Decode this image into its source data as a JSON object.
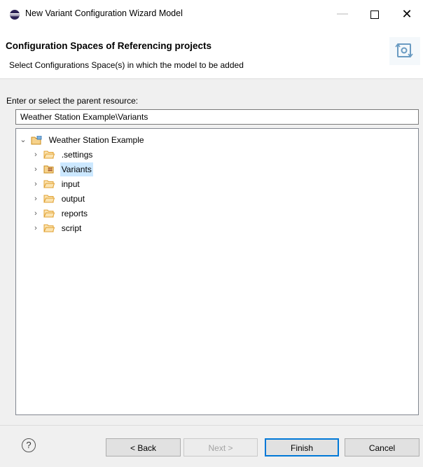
{
  "window": {
    "title": "New Variant Configuration Wizard Model",
    "min_glyph": "—",
    "close_glyph": "✕"
  },
  "banner": {
    "title": "Configuration Spaces of Referencing projects",
    "description": "Select Configurations Space(s) in which the model to be added",
    "icon": "wizard-sync-icon"
  },
  "parent": {
    "label": "Enter or select the parent resource:",
    "value": "Weather Station Example\\Variants"
  },
  "tree": {
    "root": {
      "label": "Weather Station Example",
      "expanded": true,
      "chevron": "⌄"
    },
    "children": [
      {
        "label": ".settings",
        "chevron": "›",
        "selected": false
      },
      {
        "label": "Variants",
        "chevron": "›",
        "selected": true
      },
      {
        "label": "input",
        "chevron": "›",
        "selected": false
      },
      {
        "label": "output",
        "chevron": "›",
        "selected": false
      },
      {
        "label": "reports",
        "chevron": "›",
        "selected": false
      },
      {
        "label": "script",
        "chevron": "›",
        "selected": false
      }
    ]
  },
  "footer": {
    "help": "?",
    "back_label": "< Back",
    "next_label": "Next >",
    "finish_label": "Finish",
    "cancel_label": "Cancel"
  },
  "colors": {
    "selection": "#cce8ff",
    "accent": "#0078d7",
    "folder": "#e8a93a"
  }
}
